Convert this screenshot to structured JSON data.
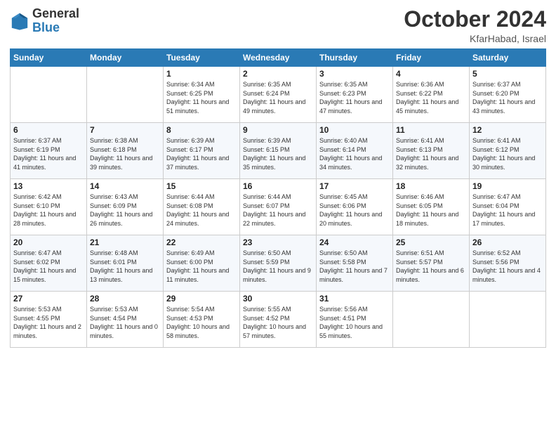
{
  "header": {
    "logo_general": "General",
    "logo_blue": "Blue",
    "title": "October 2024",
    "subtitle": "KfarHabad, Israel"
  },
  "weekdays": [
    "Sunday",
    "Monday",
    "Tuesday",
    "Wednesday",
    "Thursday",
    "Friday",
    "Saturday"
  ],
  "weeks": [
    [
      {
        "day": "",
        "sunrise": "",
        "sunset": "",
        "daylight": ""
      },
      {
        "day": "",
        "sunrise": "",
        "sunset": "",
        "daylight": ""
      },
      {
        "day": "1",
        "sunrise": "Sunrise: 6:34 AM",
        "sunset": "Sunset: 6:25 PM",
        "daylight": "Daylight: 11 hours and 51 minutes."
      },
      {
        "day": "2",
        "sunrise": "Sunrise: 6:35 AM",
        "sunset": "Sunset: 6:24 PM",
        "daylight": "Daylight: 11 hours and 49 minutes."
      },
      {
        "day": "3",
        "sunrise": "Sunrise: 6:35 AM",
        "sunset": "Sunset: 6:23 PM",
        "daylight": "Daylight: 11 hours and 47 minutes."
      },
      {
        "day": "4",
        "sunrise": "Sunrise: 6:36 AM",
        "sunset": "Sunset: 6:22 PM",
        "daylight": "Daylight: 11 hours and 45 minutes."
      },
      {
        "day": "5",
        "sunrise": "Sunrise: 6:37 AM",
        "sunset": "Sunset: 6:20 PM",
        "daylight": "Daylight: 11 hours and 43 minutes."
      }
    ],
    [
      {
        "day": "6",
        "sunrise": "Sunrise: 6:37 AM",
        "sunset": "Sunset: 6:19 PM",
        "daylight": "Daylight: 11 hours and 41 minutes."
      },
      {
        "day": "7",
        "sunrise": "Sunrise: 6:38 AM",
        "sunset": "Sunset: 6:18 PM",
        "daylight": "Daylight: 11 hours and 39 minutes."
      },
      {
        "day": "8",
        "sunrise": "Sunrise: 6:39 AM",
        "sunset": "Sunset: 6:17 PM",
        "daylight": "Daylight: 11 hours and 37 minutes."
      },
      {
        "day": "9",
        "sunrise": "Sunrise: 6:39 AM",
        "sunset": "Sunset: 6:15 PM",
        "daylight": "Daylight: 11 hours and 35 minutes."
      },
      {
        "day": "10",
        "sunrise": "Sunrise: 6:40 AM",
        "sunset": "Sunset: 6:14 PM",
        "daylight": "Daylight: 11 hours and 34 minutes."
      },
      {
        "day": "11",
        "sunrise": "Sunrise: 6:41 AM",
        "sunset": "Sunset: 6:13 PM",
        "daylight": "Daylight: 11 hours and 32 minutes."
      },
      {
        "day": "12",
        "sunrise": "Sunrise: 6:41 AM",
        "sunset": "Sunset: 6:12 PM",
        "daylight": "Daylight: 11 hours and 30 minutes."
      }
    ],
    [
      {
        "day": "13",
        "sunrise": "Sunrise: 6:42 AM",
        "sunset": "Sunset: 6:10 PM",
        "daylight": "Daylight: 11 hours and 28 minutes."
      },
      {
        "day": "14",
        "sunrise": "Sunrise: 6:43 AM",
        "sunset": "Sunset: 6:09 PM",
        "daylight": "Daylight: 11 hours and 26 minutes."
      },
      {
        "day": "15",
        "sunrise": "Sunrise: 6:44 AM",
        "sunset": "Sunset: 6:08 PM",
        "daylight": "Daylight: 11 hours and 24 minutes."
      },
      {
        "day": "16",
        "sunrise": "Sunrise: 6:44 AM",
        "sunset": "Sunset: 6:07 PM",
        "daylight": "Daylight: 11 hours and 22 minutes."
      },
      {
        "day": "17",
        "sunrise": "Sunrise: 6:45 AM",
        "sunset": "Sunset: 6:06 PM",
        "daylight": "Daylight: 11 hours and 20 minutes."
      },
      {
        "day": "18",
        "sunrise": "Sunrise: 6:46 AM",
        "sunset": "Sunset: 6:05 PM",
        "daylight": "Daylight: 11 hours and 18 minutes."
      },
      {
        "day": "19",
        "sunrise": "Sunrise: 6:47 AM",
        "sunset": "Sunset: 6:04 PM",
        "daylight": "Daylight: 11 hours and 17 minutes."
      }
    ],
    [
      {
        "day": "20",
        "sunrise": "Sunrise: 6:47 AM",
        "sunset": "Sunset: 6:02 PM",
        "daylight": "Daylight: 11 hours and 15 minutes."
      },
      {
        "day": "21",
        "sunrise": "Sunrise: 6:48 AM",
        "sunset": "Sunset: 6:01 PM",
        "daylight": "Daylight: 11 hours and 13 minutes."
      },
      {
        "day": "22",
        "sunrise": "Sunrise: 6:49 AM",
        "sunset": "Sunset: 6:00 PM",
        "daylight": "Daylight: 11 hours and 11 minutes."
      },
      {
        "day": "23",
        "sunrise": "Sunrise: 6:50 AM",
        "sunset": "Sunset: 5:59 PM",
        "daylight": "Daylight: 11 hours and 9 minutes."
      },
      {
        "day": "24",
        "sunrise": "Sunrise: 6:50 AM",
        "sunset": "Sunset: 5:58 PM",
        "daylight": "Daylight: 11 hours and 7 minutes."
      },
      {
        "day": "25",
        "sunrise": "Sunrise: 6:51 AM",
        "sunset": "Sunset: 5:57 PM",
        "daylight": "Daylight: 11 hours and 6 minutes."
      },
      {
        "day": "26",
        "sunrise": "Sunrise: 6:52 AM",
        "sunset": "Sunset: 5:56 PM",
        "daylight": "Daylight: 11 hours and 4 minutes."
      }
    ],
    [
      {
        "day": "27",
        "sunrise": "Sunrise: 5:53 AM",
        "sunset": "Sunset: 4:55 PM",
        "daylight": "Daylight: 11 hours and 2 minutes."
      },
      {
        "day": "28",
        "sunrise": "Sunrise: 5:53 AM",
        "sunset": "Sunset: 4:54 PM",
        "daylight": "Daylight: 11 hours and 0 minutes."
      },
      {
        "day": "29",
        "sunrise": "Sunrise: 5:54 AM",
        "sunset": "Sunset: 4:53 PM",
        "daylight": "Daylight: 10 hours and 58 minutes."
      },
      {
        "day": "30",
        "sunrise": "Sunrise: 5:55 AM",
        "sunset": "Sunset: 4:52 PM",
        "daylight": "Daylight: 10 hours and 57 minutes."
      },
      {
        "day": "31",
        "sunrise": "Sunrise: 5:56 AM",
        "sunset": "Sunset: 4:51 PM",
        "daylight": "Daylight: 10 hours and 55 minutes."
      },
      {
        "day": "",
        "sunrise": "",
        "sunset": "",
        "daylight": ""
      },
      {
        "day": "",
        "sunrise": "",
        "sunset": "",
        "daylight": ""
      }
    ]
  ]
}
